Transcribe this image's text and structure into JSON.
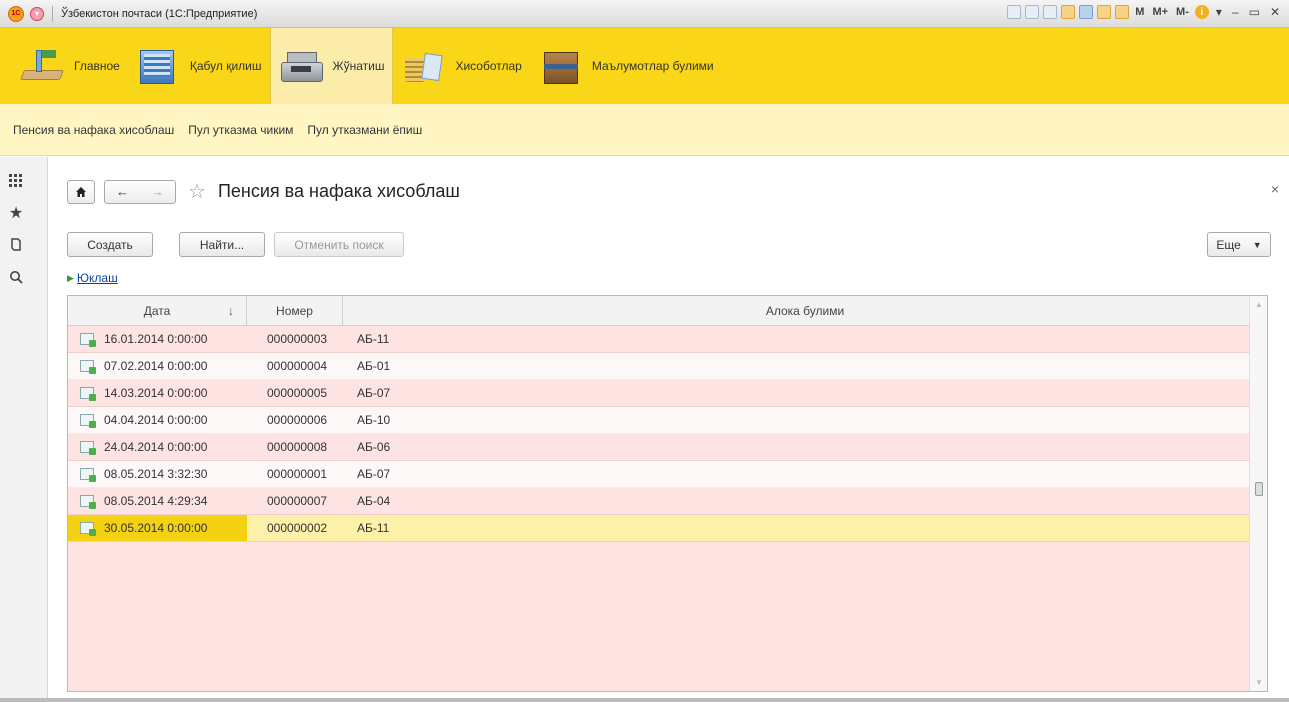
{
  "window": {
    "title": "Ўзбекистон почтаси  (1С:Предприятие)",
    "logo_text": "1С",
    "toolbar_text": [
      "M",
      "M+",
      "M-"
    ]
  },
  "sections": [
    {
      "label": "Главное",
      "icon": "main-icon",
      "active": false
    },
    {
      "label": "Қабул қилиш",
      "icon": "building-icon",
      "active": false
    },
    {
      "label": "Жўнатиш",
      "icon": "cash-register-icon",
      "active": true
    },
    {
      "label": "Хисоботлар",
      "icon": "reports-icon",
      "active": false
    },
    {
      "label": "Маълумотлар булими",
      "icon": "archive-box-icon",
      "active": false
    }
  ],
  "subpanel": {
    "items": [
      "Пенсия ва нафака хисоблаш",
      "Пул утказма чиким",
      "Пул утказмани ёпиш"
    ]
  },
  "leftbar": {
    "icons": [
      "apps-grid-icon",
      "star-icon",
      "history-icon",
      "search-icon"
    ]
  },
  "form": {
    "title": "Пенсия ва нафака хисоблаш",
    "close": "×",
    "buttons": {
      "create": "Создать",
      "find": "Найти...",
      "cancel_search": "Отменить поиск",
      "more": "Еще"
    },
    "group_link": "Юклаш"
  },
  "table": {
    "columns": [
      "Дата",
      "Номер",
      "Алока булими"
    ],
    "sort_indicator": "↓",
    "rows": [
      {
        "date": "16.01.2014 0:00:00",
        "number": "000000003",
        "dept": "АБ-11",
        "style": "pink"
      },
      {
        "date": "07.02.2014 0:00:00",
        "number": "000000004",
        "dept": "АБ-01",
        "style": "white"
      },
      {
        "date": "14.03.2014 0:00:00",
        "number": "000000005",
        "dept": "АБ-07",
        "style": "pink"
      },
      {
        "date": "04.04.2014 0:00:00",
        "number": "000000006",
        "dept": "АБ-10",
        "style": "white"
      },
      {
        "date": "24.04.2014 0:00:00",
        "number": "000000008",
        "dept": "АБ-06",
        "style": "pink"
      },
      {
        "date": "08.05.2014 3:32:30",
        "number": "000000001",
        "dept": "АБ-07",
        "style": "white"
      },
      {
        "date": "08.05.2014 4:29:34",
        "number": "000000007",
        "dept": "АБ-04",
        "style": "pink"
      },
      {
        "date": "30.05.2014 0:00:00",
        "number": "000000002",
        "dept": "АБ-11",
        "style": "sel"
      }
    ]
  },
  "colors": {
    "sections_bg": "#f9d718",
    "subpanel_bg": "#fff6c4",
    "row_pink": "#fde3e1",
    "row_selected": "#fdf1a9",
    "cell_selected": "#f5d113"
  }
}
